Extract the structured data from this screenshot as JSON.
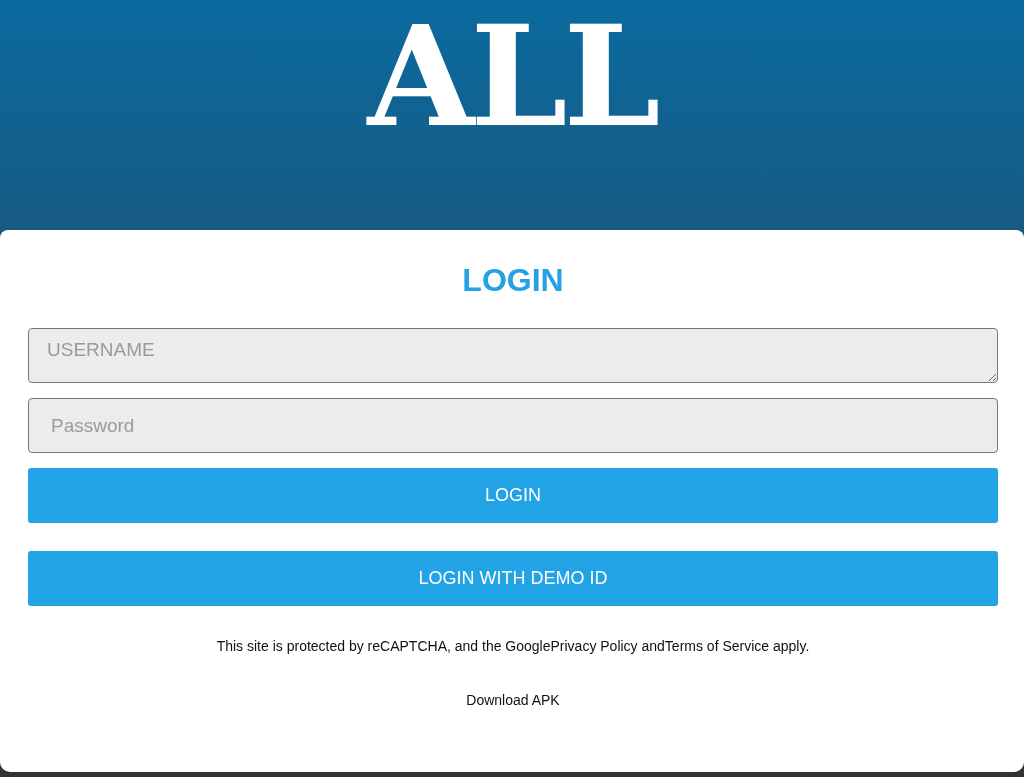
{
  "header": {
    "logo": "ALL"
  },
  "login": {
    "title": "LOGIN",
    "fields": [
      {
        "kind": "textarea",
        "placeholder": "USERNAME"
      },
      {
        "kind": "password",
        "placeholder": "Password"
      }
    ],
    "buttons": [
      "LOGIN",
      "LOGIN WITH DEMO ID"
    ],
    "notice": "This site is protected by reCAPTCHA, and the GooglePrivacy Policy andTerms of Service apply.",
    "download_link": "Download APK"
  }
}
